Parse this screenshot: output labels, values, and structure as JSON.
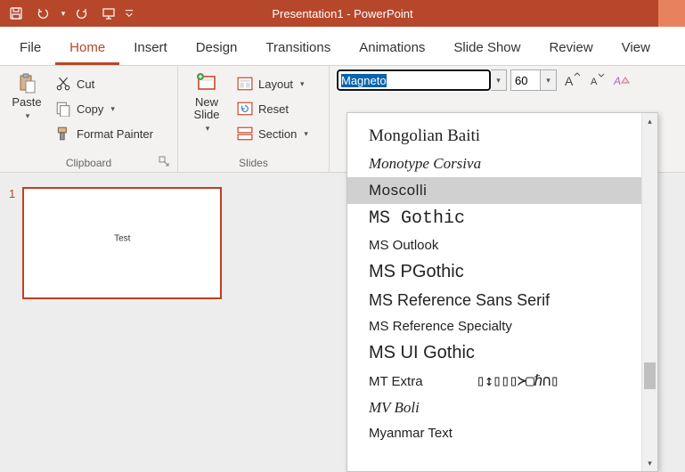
{
  "title": "Presentation1 - PowerPoint",
  "tabs": [
    "File",
    "Home",
    "Insert",
    "Design",
    "Transitions",
    "Animations",
    "Slide Show",
    "Review",
    "View"
  ],
  "active_tab": "Home",
  "clipboard": {
    "paste": "Paste",
    "cut": "Cut",
    "copy": "Copy",
    "format_painter": "Format Painter",
    "label": "Clipboard"
  },
  "slides_group": {
    "new_slide": "New\nSlide",
    "layout": "Layout",
    "reset": "Reset",
    "section": "Section",
    "label": "Slides"
  },
  "font": {
    "name": "Magneto",
    "size": "60"
  },
  "thumb": {
    "num": "1",
    "text": "Test"
  },
  "font_list": [
    {
      "label": "Mongolian Baiti",
      "style": "font-family:'Times New Roman',serif; font-size:19px;"
    },
    {
      "label": "Monotype Corsiva",
      "style": "font-family:'Brush Script MT',cursive; font-style:italic; font-size:17px;"
    },
    {
      "label": "Moscolli",
      "style": "font-family:Impact,sans-serif; letter-spacing:0.5px; font-size:17px;",
      "hover": true
    },
    {
      "label": "MS Gothic",
      "style": "font-family:'MS Gothic','Courier New',monospace; font-size:20px;"
    },
    {
      "label": "MS Outlook",
      "style": "font-family:Arial,sans-serif; font-size:15px;"
    },
    {
      "label": "MS PGothic",
      "style": "font-family:'MS PGothic',Arial,sans-serif; font-size:20px;"
    },
    {
      "label": "MS Reference Sans Serif",
      "style": "font-family:Verdana,sans-serif; font-size:18px;"
    },
    {
      "label": "MS Reference Specialty",
      "style": "font-family:Arial,sans-serif; font-size:15px;"
    },
    {
      "label": "MS UI Gothic",
      "style": "font-family:'MS UI Gothic',Arial,sans-serif; font-size:20px;"
    },
    {
      "label": "MT Extra",
      "style": "font-family:Arial,sans-serif; font-size:15px;",
      "extra": "▯↕▯▯▯≻▢ℏ∩▯"
    },
    {
      "label": "MV Boli",
      "style": "font-family:'Comic Sans MS',cursive; font-style:italic; font-size:17px;"
    },
    {
      "label": "Myanmar Text",
      "style": "font-family:Arial,sans-serif; font-size:15px;"
    }
  ]
}
